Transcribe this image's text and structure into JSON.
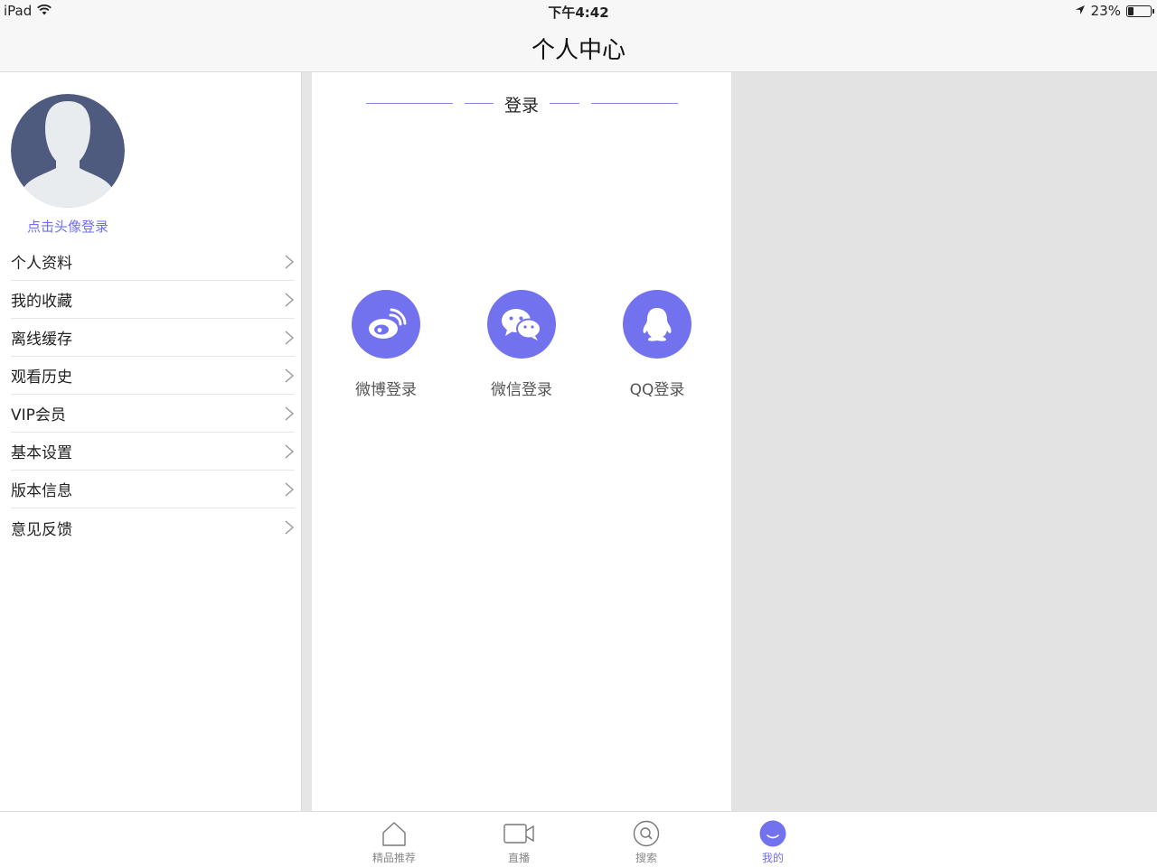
{
  "status_bar": {
    "device": "iPad",
    "time": "下午4:42",
    "battery": "23%",
    "battery_level": 0.23
  },
  "nav": {
    "title": "个人中心"
  },
  "profile": {
    "login_hint": "点击头像登录"
  },
  "menu": [
    {
      "label": "个人资料"
    },
    {
      "label": "我的收藏"
    },
    {
      "label": "离线缓存"
    },
    {
      "label": "观看历史"
    },
    {
      "label": "VIP会员"
    },
    {
      "label": "基本设置"
    },
    {
      "label": "版本信息"
    },
    {
      "label": "意见反馈"
    }
  ],
  "login": {
    "heading": "登录",
    "options": [
      {
        "label": "微博登录",
        "icon": "weibo-icon"
      },
      {
        "label": "微信登录",
        "icon": "wechat-icon"
      },
      {
        "label": "QQ登录",
        "icon": "qq-icon"
      }
    ]
  },
  "tabs": [
    {
      "label": "精品推荐",
      "icon": "home-icon"
    },
    {
      "label": "直播",
      "icon": "video-camera-icon"
    },
    {
      "label": "搜索",
      "icon": "search-icon"
    },
    {
      "label": "我的",
      "icon": "profile-icon",
      "active": true
    }
  ],
  "colors": {
    "accent": "#7272ef",
    "panel_gray": "#e3e3e3",
    "avatar_bg": "#4f5b7e"
  }
}
